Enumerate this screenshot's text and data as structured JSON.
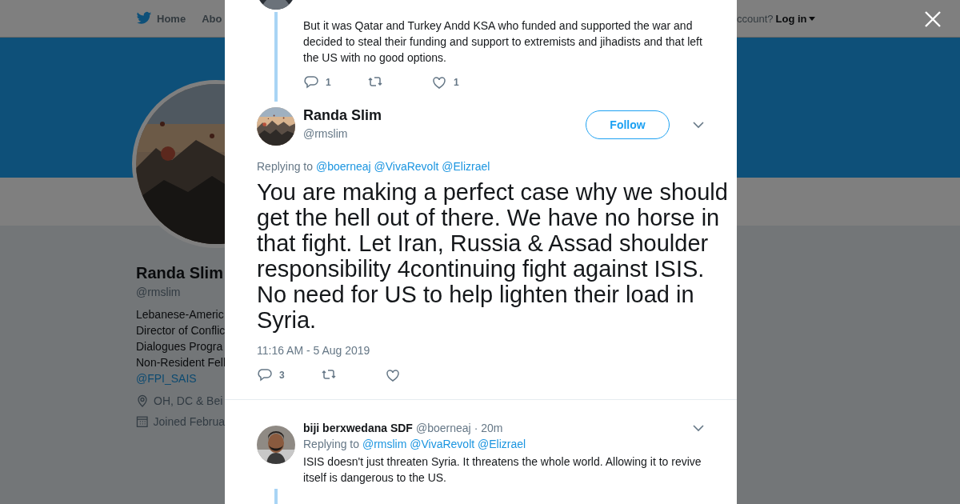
{
  "nav": {
    "items": [
      {
        "label": "Home"
      },
      {
        "label": "Abo"
      }
    ],
    "account_prompt": "ccount?",
    "login": "Log in"
  },
  "profile": {
    "name": "Randa Slim",
    "handle": "@rmslim",
    "bio": [
      "Lebanese-Americ",
      "Director of Conflic",
      "Dialogues Progra",
      "Non-Resident Fell"
    ],
    "bio_link": "@FPI_SAIS",
    "location": "OH, DC & Bei",
    "joined": "Joined Februa"
  },
  "previous_tweet": {
    "text": "But it was Qatar and Turkey Andd KSA who funded and supported the war and decided to steal their funding and support to extremists and jihadists and that left the US with no good options.",
    "replies": "1",
    "likes": "1"
  },
  "tweet": {
    "name": "Randa Slim",
    "handle": "@rmslim",
    "follow": "Follow",
    "replying_label": "Replying to",
    "replying_to": [
      "@boerneaj",
      "@VivaRevolt",
      "@Elizrael"
    ],
    "text": "You are making a perfect case why we should get the hell out of there. We have no horse in that fight. Let Iran, Russia & Assad shoulder responsibility 4continuing fight against ISIS. No need for US to help lighten their load in Syria.",
    "time": "11:16 AM - 5 Aug 2019",
    "replies": "3"
  },
  "reply": {
    "name": "biji berxwedana SDF",
    "handle": "@boerneaj",
    "age": "· 20m",
    "replying_label": "Replying to",
    "replying_to": [
      "@rmslim",
      "@VivaRevolt",
      "@Elizrael"
    ],
    "text": "ISIS doesn't just threaten Syria. It threatens the whole world. Allowing it to revive itself is dangerous to the US."
  }
}
